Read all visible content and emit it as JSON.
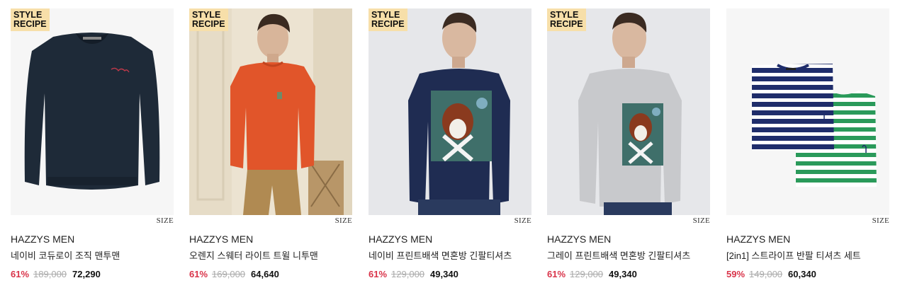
{
  "products": [
    {
      "badge_line1": "STYLE",
      "badge_line2": "RECIPE",
      "size_label": "SIZE",
      "brand": "HAZZYS MEN",
      "name": "네이비 코듀로이 조직 맨투맨",
      "discount": "61%",
      "original_price": "189,000",
      "sale_price": "72,290",
      "image": "navy-corduroy-sweatshirt"
    },
    {
      "badge_line1": "STYLE",
      "badge_line2": "RECIPE",
      "size_label": "SIZE",
      "brand": "HAZZYS MEN",
      "name": "오렌지 스웨터 라이트 트윌 니투맨",
      "discount": "61%",
      "original_price": "169,000",
      "sale_price": "64,640",
      "image": "model-orange-sweater"
    },
    {
      "badge_line1": "STYLE",
      "badge_line2": "RECIPE",
      "size_label": "SIZE",
      "brand": "HAZZYS MEN",
      "name": "네이비 프린트배색 면혼방 긴팔티셔츠",
      "discount": "61%",
      "original_price": "129,000",
      "sale_price": "49,340",
      "image": "model-navy-print-tee"
    },
    {
      "badge_line1": "STYLE",
      "badge_line2": "RECIPE",
      "size_label": "SIZE",
      "brand": "HAZZYS MEN",
      "name": "그레이 프린트배색 면혼방 긴팔티셔츠",
      "discount": "61%",
      "original_price": "129,000",
      "sale_price": "49,340",
      "image": "model-grey-print-tee"
    },
    {
      "size_label": "SIZE",
      "brand": "HAZZYS MEN",
      "name": "[2in1] 스트라이프 반팔 티셔츠 세트",
      "discount": "59%",
      "original_price": "149,000",
      "sale_price": "60,340",
      "image": "striped-tee-set"
    }
  ],
  "colors": {
    "badge": "#f7dfa9",
    "discount": "#d9344a",
    "original_price": "#aaaaaa"
  }
}
